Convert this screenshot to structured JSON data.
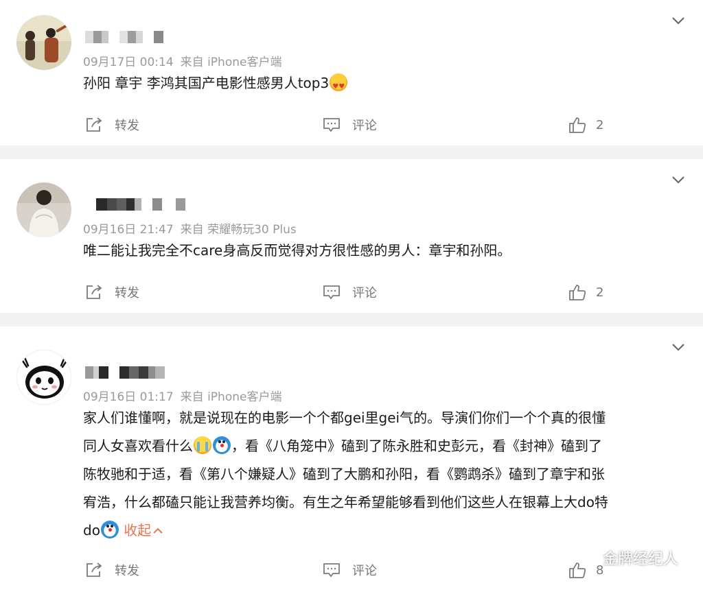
{
  "posts": [
    {
      "meta_time": "09月17日 00:14",
      "meta_from": "来自 iPhone客户端",
      "text_lines": [
        "孙阳 章宇 李鸿其国产电影性感男人top3"
      ],
      "repost_label": "转发",
      "comment_label": "评论",
      "like_count": "2"
    },
    {
      "meta_time": "09月16日 21:47",
      "meta_from": "来自 荣耀畅玩30 Plus",
      "text_lines": [
        "唯二能让我完全不care身高反而觉得对方很性感的男人：章宇和孙阳。"
      ],
      "repost_label": "转发",
      "comment_label": "评论",
      "like_count": "2"
    },
    {
      "meta_time": "09月16日 01:17",
      "meta_from": "来自 iPhone客户端",
      "text_lines": [
        "家人们谁懂啊，就是说现在的电影一个个都gei里gei气的。导演们你们一个个真的很懂",
        "同人女喜欢看什么",
        "，看《八角笼中》磕到了陈永胜和史彭元，看《封神》磕到了",
        "陈牧驰和于适，看《第八个嫌疑人》磕到了大鹏和孙阳，看《鹦鹉杀》磕到了章宇和张",
        "宥浩，什么都磕只能让我营养均衡。有生之年希望能够看到他们这些人在银幕上大do特",
        "do"
      ],
      "collapse_label": "收起",
      "repost_label": "转发",
      "comment_label": "评论",
      "like_count": "8"
    }
  ],
  "watermark": {
    "text": "金牌经纪人"
  },
  "colors": {
    "text": "#1a1a1a",
    "meta": "#9a9a9a",
    "action": "#777777",
    "collapse": "#eb7350",
    "separator": "#f2f2f2"
  },
  "icons": {
    "chevron": "chevron-down-icon",
    "repost": "repost-icon",
    "comment": "comment-icon",
    "like": "thumbs-up-icon",
    "watermark": "wechat-icon"
  }
}
